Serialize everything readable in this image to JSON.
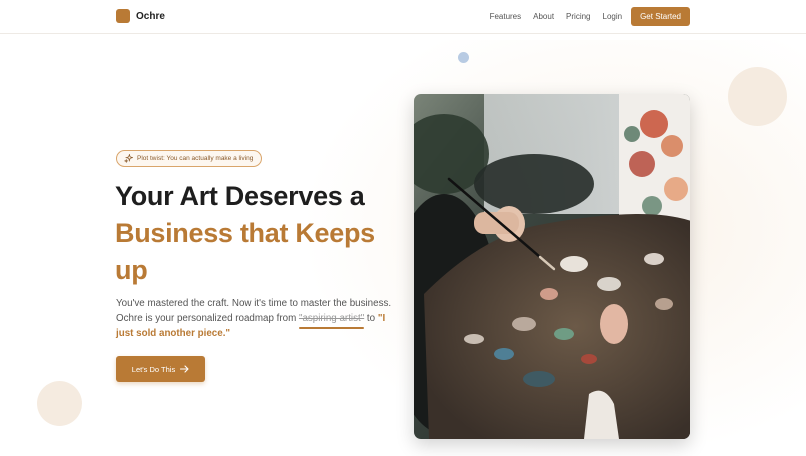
{
  "brand": {
    "name": "Ochre",
    "accent": "#b97a35"
  },
  "nav": {
    "links": [
      "Features",
      "About",
      "Pricing",
      "Login"
    ],
    "cta_label": "Get Started"
  },
  "hero": {
    "badge": {
      "icon": "sparkle-icon",
      "text": "Plot twist: You can actually make a living"
    },
    "title_line1": "Your Art Deserves a",
    "title_line2": "Business that Keeps",
    "title_line3": "up",
    "desc_part1": "You've mastered the craft. Now it's time to master the business. Ochre is your personalized roadmap from ",
    "desc_struck": "\"aspiring artist\"",
    "desc_part2": " to ",
    "desc_quote": "\"I just sold another piece.\"",
    "cta_label": "Let's Do This",
    "cta_icon": "arrow-right-icon",
    "image": "artist-painting-palette-photo"
  }
}
